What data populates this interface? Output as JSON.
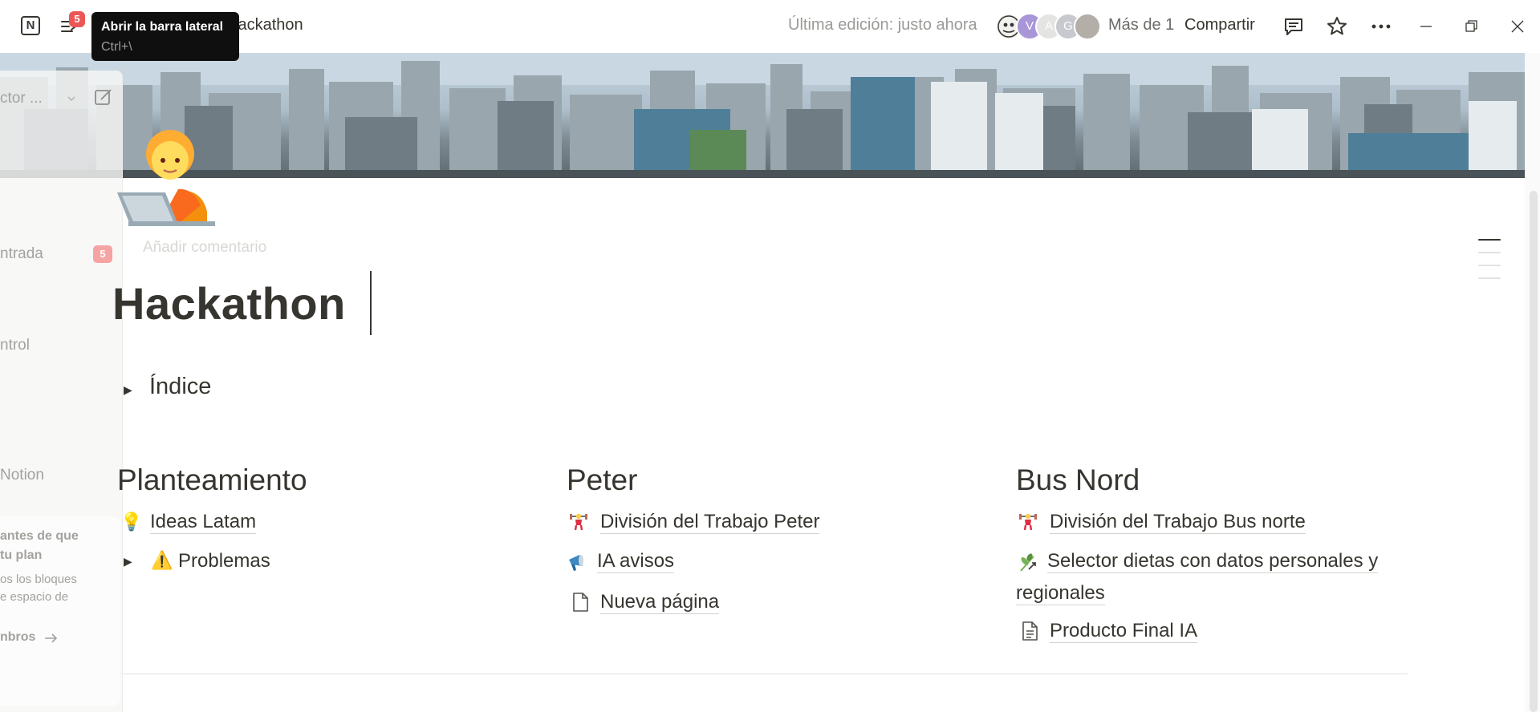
{
  "topbar": {
    "notification_count": "5",
    "breadcrumb": "Hackathon",
    "tooltip_title": "Abrir la barra lateral",
    "tooltip_shortcut": "Ctrl+\\",
    "last_edit": "Última edición: justo ahora",
    "avatar_letters": [
      "V",
      "A",
      "G"
    ],
    "more_count": "Más de 1",
    "share_label": "Compartir"
  },
  "sidebar": {
    "workspace_label": "ctor ...",
    "inbox_label": "ntrada",
    "inbox_count": "5",
    "control_label": "ntrol",
    "notion_label": "Notion",
    "upgrade_line1": "antes de que",
    "upgrade_line2": "tu plan",
    "upgrade_line3": "os los bloques",
    "upgrade_line4": "e espacio de",
    "members_label": "nbros"
  },
  "page": {
    "add_comment": "Añadir comentario",
    "title": "Hackathon",
    "toc_label": "Índice",
    "columns": [
      {
        "heading": "Planteamiento",
        "items": [
          {
            "label": "Ideas Latam",
            "icon": "lightbulb-icon"
          },
          {
            "label": "Problemas",
            "icon": "warning-icon"
          }
        ]
      },
      {
        "heading": "Peter",
        "items": [
          {
            "label": "División del Trabajo Peter",
            "icon": "weightlifter-icon"
          },
          {
            "label": "IA  avisos",
            "icon": "megaphone-icon"
          },
          {
            "label": "Nueva página",
            "icon": "page-icon"
          }
        ]
      },
      {
        "heading": "Bus Nord",
        "items": [
          {
            "label": "División del Trabajo Bus norte",
            "icon": "weightlifter-icon"
          },
          {
            "label": "Selector dietas con datos personales y",
            "label2": "regionales",
            "icon": "herb-icon"
          },
          {
            "label": "Producto Final IA",
            "icon": "document-icon"
          }
        ]
      }
    ]
  },
  "colors": {
    "text": "#37352f",
    "muted": "#9b9a97",
    "badge": "#eb5757",
    "tooltip_bg": "#0f0f0f"
  }
}
